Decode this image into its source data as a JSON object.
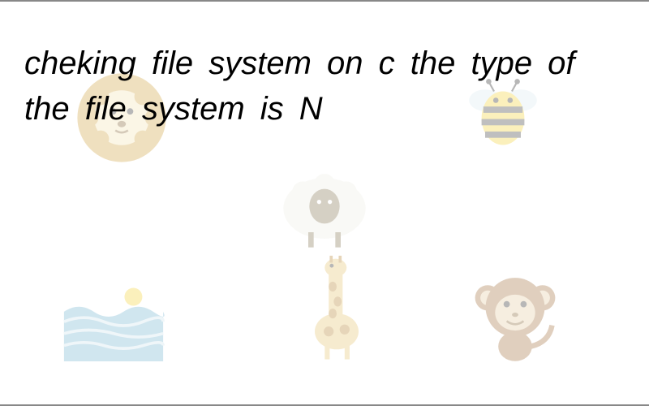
{
  "question": {
    "text": "cheking file system on c the type of the file system is N"
  },
  "decorations": {
    "lion_label": "lion",
    "sheep_label": "sheep",
    "bee_label": "bee",
    "sea_label": "sea",
    "giraffe_label": "giraffe",
    "monkey_label": "monkey"
  },
  "colors": {
    "lion_mane": "#d4a84a",
    "lion_face": "#f5e6b8",
    "sheep_body": "#f0f0e8",
    "sheep_face": "#8a7a5a",
    "bee_body": "#f5d542",
    "bee_stripe": "#4a4a4a",
    "sea_water": "#7ab8d4",
    "sea_foam": "#d4e8f0",
    "giraffe_body": "#e8c878",
    "giraffe_spot": "#b88a3a",
    "monkey_body": "#a87848",
    "monkey_face": "#e8d0a8"
  }
}
